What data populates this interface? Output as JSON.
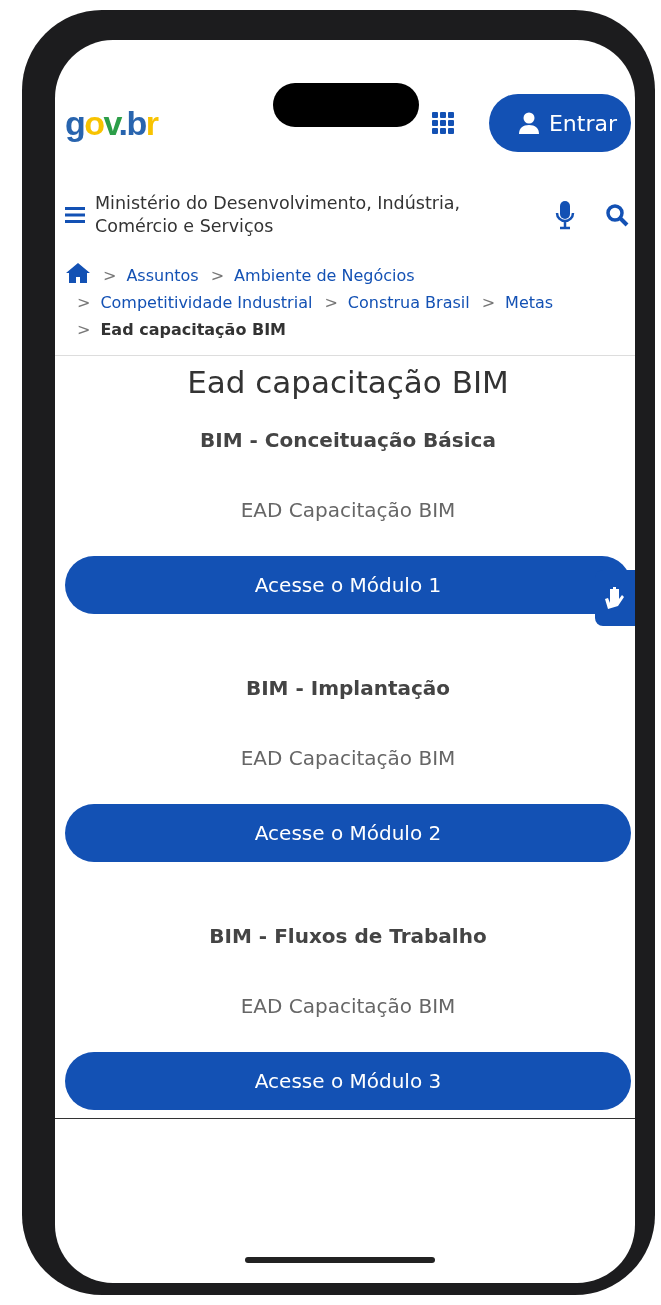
{
  "header": {
    "logo": "gov.br",
    "login_button": "Entrar"
  },
  "ministry": {
    "name": "Ministério do Desenvolvimento, Indústria, Comércio e Serviços"
  },
  "breadcrumb": [
    {
      "separator": ">",
      "label": "Assuntos",
      "current": false
    },
    {
      "separator": ">",
      "label": "Ambiente de Negócios",
      "current": false
    },
    {
      "separator": ">",
      "label": "Competitividade Industrial",
      "current": false
    },
    {
      "separator": ">",
      "label": "Construa Brasil",
      "current": false
    },
    {
      "separator": ">",
      "label": "Metas",
      "current": false
    },
    {
      "separator": ">",
      "label": "Ead capacitação BIM",
      "current": true
    }
  ],
  "page_title": "Ead capacitação BIM",
  "modules": [
    {
      "title": "BIM - Conceituação Básica",
      "subtitle": "EAD Capacitação BIM",
      "button": "Acesse o Módulo 1"
    },
    {
      "title": "BIM - Implantação",
      "subtitle": "EAD Capacitação BIM",
      "button": "Acesse o Módulo 2"
    },
    {
      "title": "BIM - Fluxos de Trabalho",
      "subtitle": "EAD Capacitação BIM",
      "button": "Acesse o Módulo 3"
    }
  ]
}
